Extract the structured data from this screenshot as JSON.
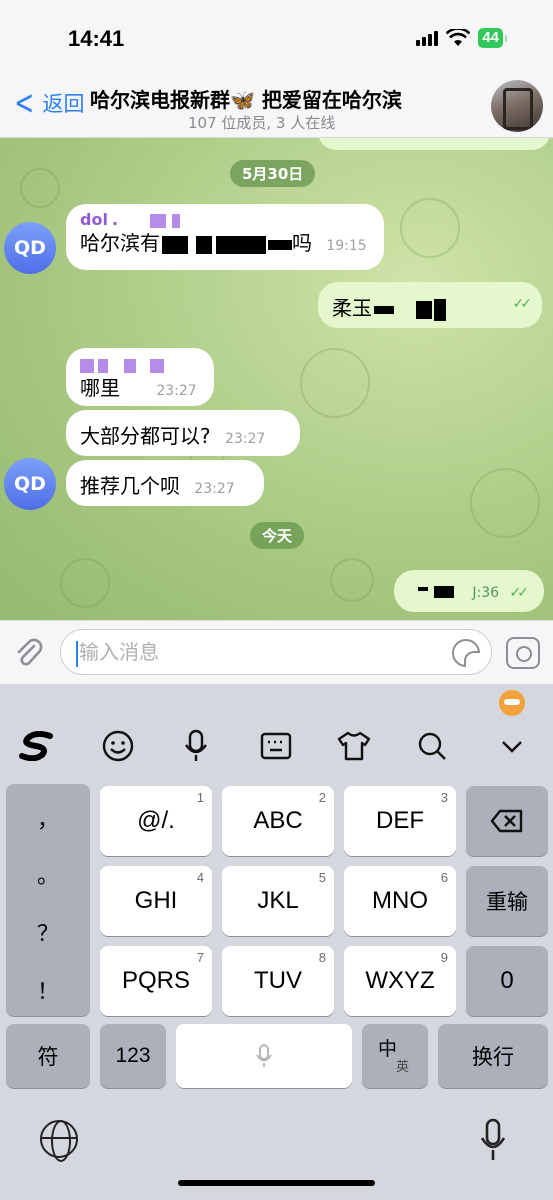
{
  "status": {
    "time": "14:41",
    "battery": "44"
  },
  "header": {
    "back_label": "返回",
    "title": "哈尔滨电报新群🦋 把爱留在哈尔滨",
    "subtitle": "107 位成员, 3 人在线"
  },
  "chat": {
    "date_1": "5月30日",
    "date_2": "今天",
    "messages": [
      {
        "sender": "dol",
        "text_a": "哈尔滨有",
        "text_b": "吗",
        "time": "19:15",
        "avatar": "QD"
      },
      {
        "text": "柔玉",
        "status": "read"
      },
      {
        "text": "哪里",
        "time": "23:27"
      },
      {
        "text": "大部分都可以?",
        "time": "23:27"
      },
      {
        "text": "推荐几个呗",
        "time": "23:27",
        "avatar": "QD"
      },
      {
        "time": "J:36",
        "status": "read"
      }
    ]
  },
  "composer": {
    "placeholder": "输入消息"
  },
  "keyboard": {
    "punct": [
      "，",
      "。",
      "？",
      "！"
    ],
    "keys": [
      {
        "label": "@/.",
        "num": "1"
      },
      {
        "label": "ABC",
        "num": "2"
      },
      {
        "label": "DEF",
        "num": "3"
      },
      {
        "label": "GHI",
        "num": "4"
      },
      {
        "label": "JKL",
        "num": "5"
      },
      {
        "label": "MNO",
        "num": "6"
      },
      {
        "label": "PQRS",
        "num": "7"
      },
      {
        "label": "TUV",
        "num": "8"
      },
      {
        "label": "WXYZ",
        "num": "9"
      }
    ],
    "reenter": "重输",
    "zero": "0",
    "symbols": "符",
    "numbers": "123",
    "lang_main": "中",
    "lang_sub": "英",
    "return": "换行"
  },
  "colors": {
    "accent": "#2b7ff0",
    "sender": "#8e5bd5",
    "out_bubble": "#e5f7cd",
    "avatar": "#5a7cf0"
  }
}
